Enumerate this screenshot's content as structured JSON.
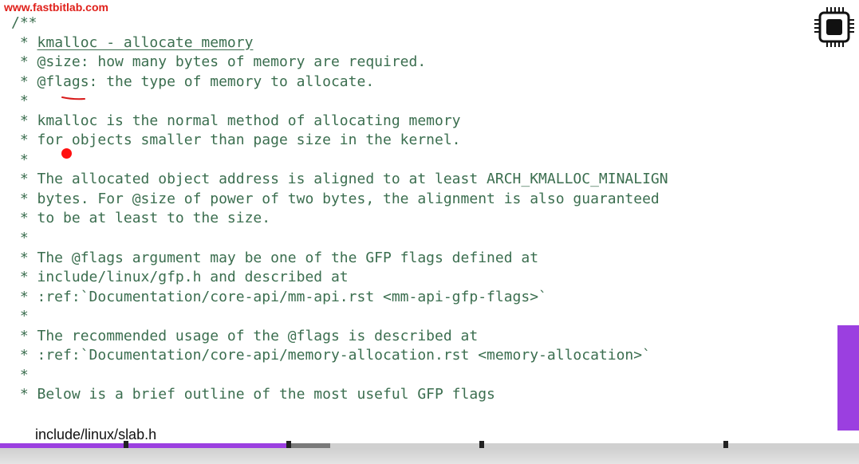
{
  "watermark": "www.fastbitlab.com",
  "code": {
    "lines": [
      "/**",
      " * kmalloc - allocate memory",
      " * @size: how many bytes of memory are required.",
      " * @flags: the type of memory to allocate.",
      " *",
      " * kmalloc is the normal method of allocating memory",
      " * for objects smaller than page size in the kernel.",
      " *",
      " * The allocated object address is aligned to at least ARCH_KMALLOC_MINALIGN",
      " * bytes. For @size of power of two bytes, the alignment is also guaranteed",
      " * to be at least to the size.",
      " *",
      " * The @flags argument may be one of the GFP flags defined at",
      " * include/linux/gfp.h and described at",
      " * :ref:`Documentation/core-api/mm-api.rst <mm-api-gfp-flags>`",
      " *",
      " * The recommended usage of the @flags is described at",
      " * :ref:`Documentation/core-api/memory-allocation.rst <memory-allocation>`",
      " *",
      " * Below is a brief outline of the most useful GFP flags"
    ],
    "line1_prefix": " * ",
    "line1_underlined": "kmalloc - allocate memory"
  },
  "caption": "include/linux/slab.h",
  "icon": "chip-icon",
  "progress": {
    "played_fraction": 0.335,
    "buffered_fraction": 0.384,
    "chapter_markers": [
      0.147,
      0.336,
      0.561,
      0.845
    ]
  },
  "colors": {
    "code_text": "#3b6e4f",
    "watermark": "#e0201a",
    "accent": "#9b3fe0",
    "laser": "#ff1010"
  }
}
